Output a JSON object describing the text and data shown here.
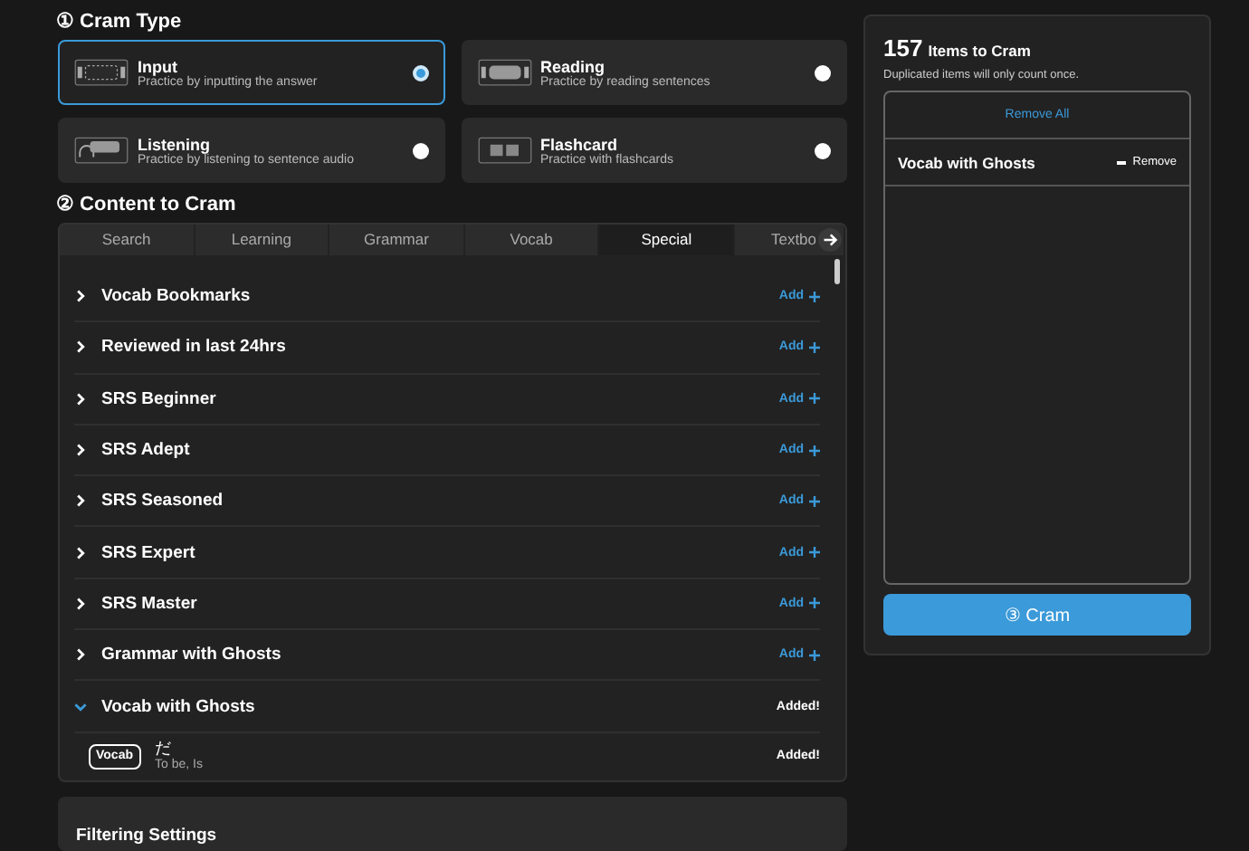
{
  "cram_type": {
    "heading": "① Cram Type",
    "options": [
      {
        "kind": "input",
        "title": "Input",
        "description": "Practice by inputting the answer",
        "selected": true
      },
      {
        "kind": "reading",
        "title": "Reading",
        "description": "Practice by reading sentences",
        "selected": false
      },
      {
        "kind": "listening",
        "title": "Listening",
        "description": "Practice by listening to sentence audio",
        "selected": false
      },
      {
        "kind": "flashcard",
        "title": "Flashcard",
        "description": "Practice with flashcards",
        "selected": false
      }
    ]
  },
  "content": {
    "heading": "② Content to Cram",
    "tabs": [
      {
        "label": "Search",
        "selected": false
      },
      {
        "label": "Learning",
        "selected": false
      },
      {
        "label": "Grammar",
        "selected": false
      },
      {
        "label": "Vocab",
        "selected": false
      },
      {
        "label": "Special",
        "selected": true
      },
      {
        "label": "Textbo",
        "selected": false
      }
    ],
    "rows": [
      {
        "label": "Vocab Bookmarks",
        "added": false,
        "expanded": false,
        "action": "Add"
      },
      {
        "label": "Reviewed in last 24hrs",
        "added": false,
        "expanded": false,
        "action": "Add"
      },
      {
        "label": "SRS Beginner",
        "added": false,
        "expanded": false,
        "action": "Add"
      },
      {
        "label": "SRS Adept",
        "added": false,
        "expanded": false,
        "action": "Add"
      },
      {
        "label": "SRS Seasoned",
        "added": false,
        "expanded": false,
        "action": "Add"
      },
      {
        "label": "SRS Expert",
        "added": false,
        "expanded": false,
        "action": "Add"
      },
      {
        "label": "SRS Master",
        "added": false,
        "expanded": false,
        "action": "Add"
      },
      {
        "label": "Grammar with Ghosts",
        "added": false,
        "expanded": false,
        "action": "Add"
      },
      {
        "label": "Vocab with Ghosts",
        "added": true,
        "expanded": true,
        "action": "Added!",
        "children": [
          {
            "tag": "Vocab",
            "term": "だ",
            "meaning": "To be, Is",
            "action": "Added!"
          }
        ]
      }
    ]
  },
  "filtering": {
    "heading": "Filtering Settings"
  },
  "summary": {
    "count": "157",
    "title": "Items to Cram",
    "note": "Duplicated items will only count once.",
    "remove_all": "Remove All",
    "items": [
      {
        "label": "Vocab with Ghosts",
        "action": "Remove"
      }
    ],
    "cram_button": "③ Cram"
  }
}
